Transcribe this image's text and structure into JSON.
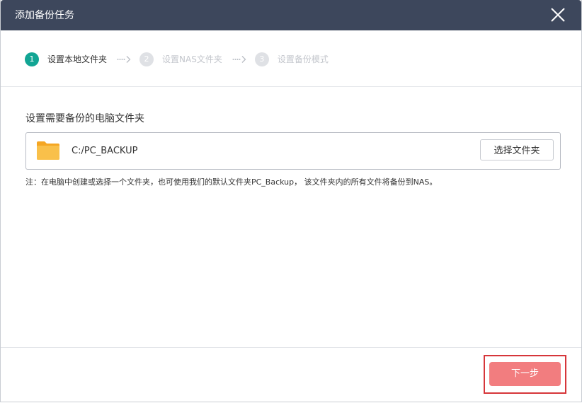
{
  "dialog": {
    "title": "添加备份任务",
    "close_icon": "close-icon"
  },
  "steps": [
    {
      "number": "1",
      "label": "设置本地文件夹",
      "state": "active"
    },
    {
      "number": "2",
      "label": "设置NAS文件夹",
      "state": "inactive"
    },
    {
      "number": "3",
      "label": "设置备份模式",
      "state": "inactive"
    }
  ],
  "main": {
    "section_title": "设置需要备份的电脑文件夹",
    "folder_icon": "folder-icon",
    "folder_path": "C:/PC_BACKUP",
    "choose_button_label": "选择文件夹",
    "note": "注：在电脑中创建或选择一个文件夹，也可使用我们的默认文件夹PC_Backup， 该文件夹内的所有文件将备份到NAS。"
  },
  "footer": {
    "next_button_label": "下一步"
  },
  "colors": {
    "titlebar": "#3d475c",
    "step_active": "#12a594",
    "step_inactive": "#dfe1e5",
    "next_button": "#f27d7f",
    "highlight_border": "#d6363a",
    "folder_icon": "#f7b733"
  }
}
